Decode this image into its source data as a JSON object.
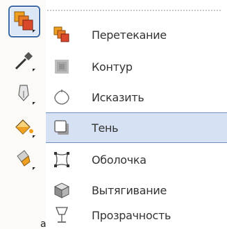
{
  "flyout": {
    "items": [
      {
        "label": "Перетекание",
        "icon": "blend-icon"
      },
      {
        "label": "Контур",
        "icon": "contour-icon"
      },
      {
        "label": "Исказить",
        "icon": "distort-icon"
      },
      {
        "label": "Тень",
        "icon": "drop-shadow-icon",
        "selected": true
      },
      {
        "label": "Оболочка",
        "icon": "envelope-icon"
      },
      {
        "label": "Вытягивание",
        "icon": "extrude-icon"
      },
      {
        "label": "Прозрачность",
        "icon": "transparency-icon"
      }
    ]
  },
  "toolbox": {
    "tools": [
      {
        "name": "interactive-effects-tool",
        "icon": "blend-icon",
        "active": true
      },
      {
        "name": "eyedropper-tool",
        "icon": "eyedropper-icon"
      },
      {
        "name": "outline-tool",
        "icon": "pen-nib-icon"
      },
      {
        "name": "fill-tool",
        "icon": "paint-bucket-icon"
      },
      {
        "name": "interactive-fill-tool",
        "icon": "interactive-fill-icon"
      }
    ]
  },
  "corner_mark": "a",
  "colors": {
    "selection": "#d6e2f3",
    "selection_border": "#6e8fc2",
    "active_tool_border": "#3e6aa7",
    "orange": "#f0a020",
    "red": "#d9482b"
  }
}
